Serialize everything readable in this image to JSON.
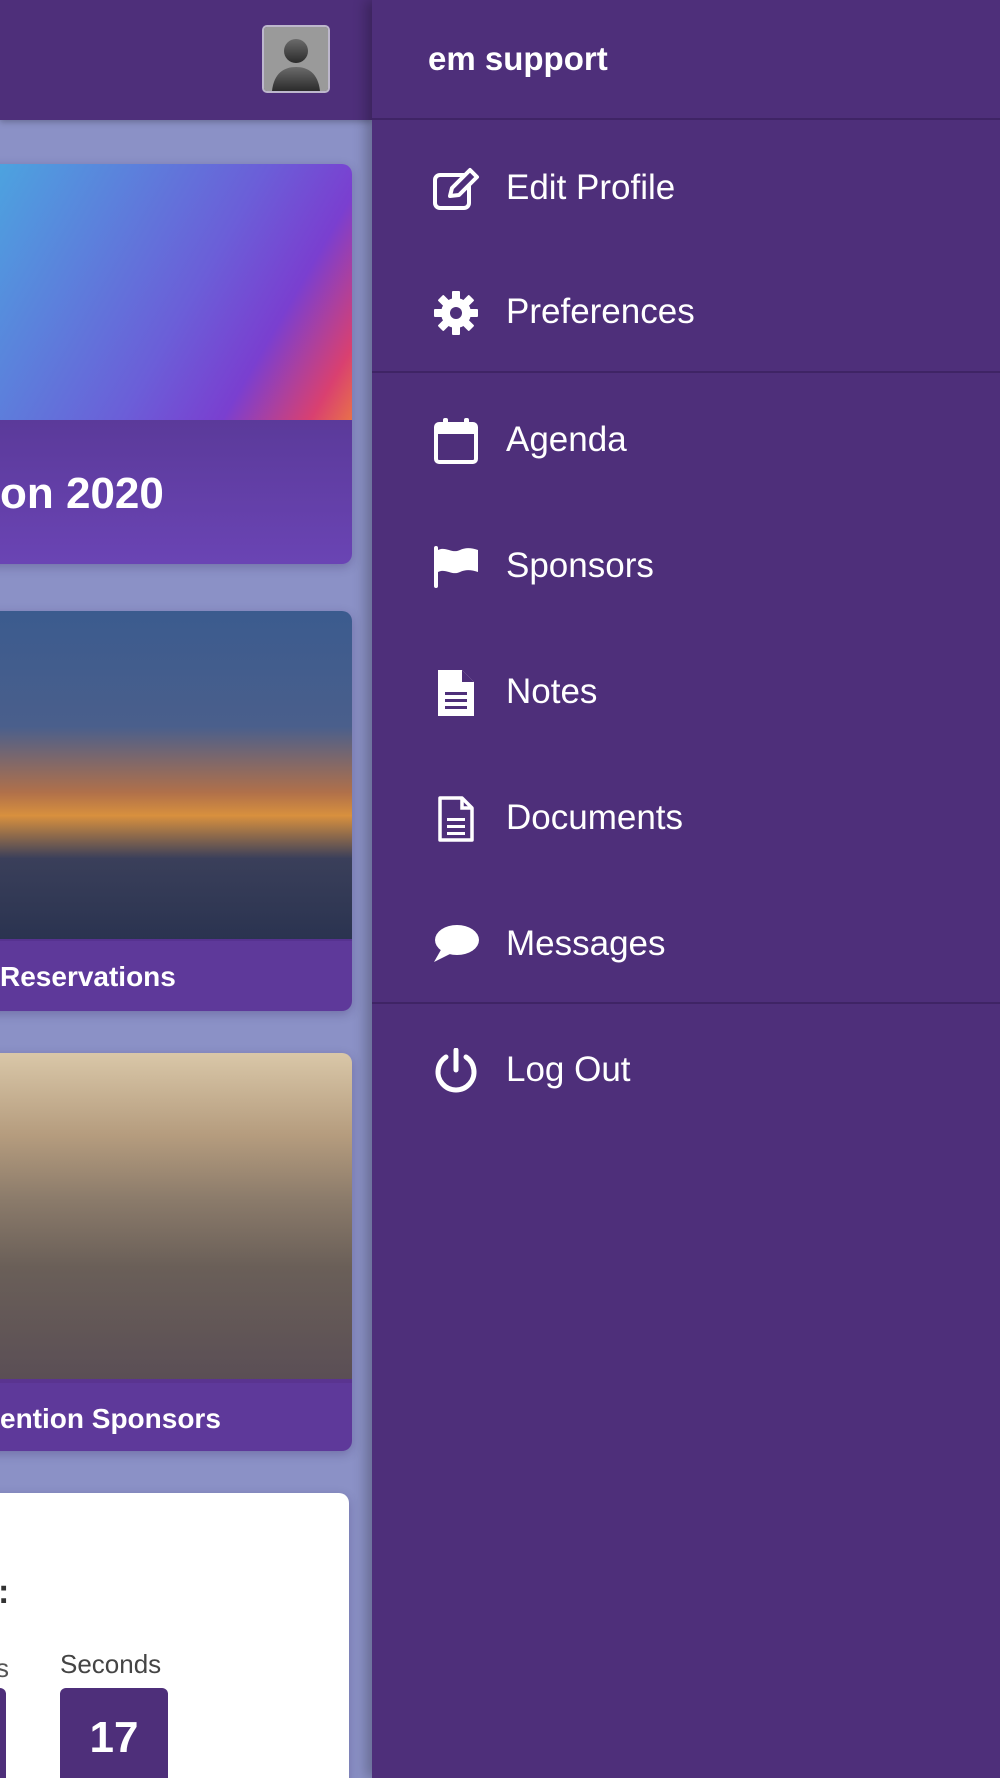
{
  "page": {
    "card1_title": "on 2020",
    "card2_title": "Reservations",
    "card3_title": "ention Sponsors",
    "countdown": {
      "colon": ":",
      "partial_label": "s",
      "seconds_label": "Seconds",
      "seconds_value": "17"
    }
  },
  "drawer": {
    "user_name": "em support",
    "items": [
      {
        "label": "Edit Profile",
        "icon": "edit-icon"
      },
      {
        "label": "Preferences",
        "icon": "gear-icon"
      },
      {
        "label": "Agenda",
        "icon": "calendar-icon"
      },
      {
        "label": "Sponsors",
        "icon": "flag-icon"
      },
      {
        "label": "Notes",
        "icon": "note-icon"
      },
      {
        "label": "Documents",
        "icon": "document-icon"
      },
      {
        "label": "Messages",
        "icon": "message-icon"
      },
      {
        "label": "Log Out",
        "icon": "power-icon"
      }
    ]
  },
  "colors": {
    "brand_purple": "#4e2f7a",
    "page_background": "#8b91c6"
  }
}
